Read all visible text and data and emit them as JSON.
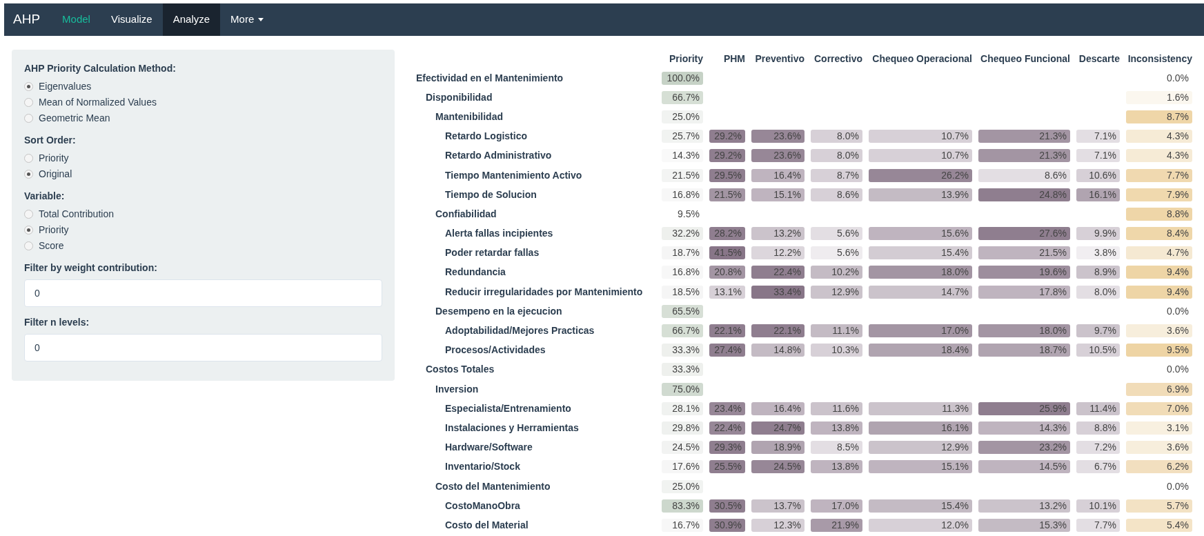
{
  "navbar": {
    "brand": "AHP",
    "items": [
      {
        "label": "Model",
        "kind": "link",
        "selected": false,
        "highlighted": true
      },
      {
        "label": "Visualize",
        "kind": "link",
        "selected": false,
        "highlighted": false
      },
      {
        "label": "Analyze",
        "kind": "link",
        "selected": true,
        "highlighted": false
      },
      {
        "label": "More",
        "kind": "dropdown",
        "selected": false,
        "highlighted": false
      }
    ]
  },
  "sidebar": {
    "groups": [
      {
        "kind": "radio",
        "label": "AHP Priority Calculation Method:",
        "options": [
          {
            "label": "Eigenvalues",
            "selected": true
          },
          {
            "label": "Mean of Normalized Values",
            "selected": false
          },
          {
            "label": "Geometric Mean",
            "selected": false
          }
        ]
      },
      {
        "kind": "radio",
        "label": "Sort Order:",
        "options": [
          {
            "label": "Priority",
            "selected": false
          },
          {
            "label": "Original",
            "selected": true
          }
        ]
      },
      {
        "kind": "radio",
        "label": "Variable:",
        "options": [
          {
            "label": "Total Contribution",
            "selected": false
          },
          {
            "label": "Priority",
            "selected": true
          },
          {
            "label": "Score",
            "selected": false
          }
        ]
      },
      {
        "kind": "input",
        "label": "Filter by weight contribution:",
        "value": "0"
      },
      {
        "kind": "input",
        "label": "Filter n levels:",
        "value": "0"
      }
    ]
  },
  "table": {
    "columns": [
      "Priority",
      "PHM",
      "Preventivo",
      "Correctivo",
      "Chequeo Operacional",
      "Chequeo Funcional",
      "Descarte",
      "Inconsistency"
    ],
    "rows": [
      {
        "name": "Efectividad en el Mantenimiento",
        "priority": {
          "text": "100.0%",
          "color": "#c6d2c6"
        },
        "inconsistency": {
          "text": "0.0%",
          "color": "#ffffff"
        },
        "children": [
          {
            "name": "Disponibilidad",
            "priority": {
              "text": "66.7%",
              "color": "#d6dfd5"
            },
            "inconsistency": {
              "text": "1.6%",
              "color": "#fbf7ef"
            },
            "children": [
              {
                "name": "Mantenibilidad",
                "priority": {
                  "text": "25.0%",
                  "color": "#f1f3f1"
                },
                "inconsistency": {
                  "text": "8.7%",
                  "color": "#efd6a8"
                },
                "children": [
                  {
                    "name": "Retardo Logistico",
                    "priority": {
                      "text": "25.7%",
                      "color": "#f1f3f1"
                    },
                    "scores": [
                      {
                        "text": "29.2%",
                        "color": "#8f7e8f"
                      },
                      {
                        "text": "23.6%",
                        "color": "#978797"
                      },
                      {
                        "text": "8.0%",
                        "color": "#d7d0d7"
                      },
                      {
                        "text": "10.7%",
                        "color": "#d7d0d7"
                      },
                      {
                        "text": "21.3%",
                        "color": "#a395a3"
                      },
                      {
                        "text": "7.1%",
                        "color": "#e3dee3"
                      }
                    ],
                    "inconsistency": {
                      "text": "4.3%",
                      "color": "#f6ebd6"
                    }
                  },
                  {
                    "name": "Retardo Administrativo",
                    "priority": {
                      "text": "14.3%",
                      "color": "#f9f9f9"
                    },
                    "scores": [
                      {
                        "text": "29.2%",
                        "color": "#8f7e8f"
                      },
                      {
                        "text": "23.6%",
                        "color": "#978797"
                      },
                      {
                        "text": "8.0%",
                        "color": "#d7d0d7"
                      },
                      {
                        "text": "10.7%",
                        "color": "#d7d0d7"
                      },
                      {
                        "text": "21.3%",
                        "color": "#a395a3"
                      },
                      {
                        "text": "7.1%",
                        "color": "#e3dee3"
                      }
                    ],
                    "inconsistency": {
                      "text": "4.3%",
                      "color": "#f6ebd6"
                    }
                  },
                  {
                    "name": "Tiempo Mantenimiento Activo",
                    "priority": {
                      "text": "21.5%",
                      "color": "#f3f4f3"
                    },
                    "scores": [
                      {
                        "text": "29.5%",
                        "color": "#8f7e8f"
                      },
                      {
                        "text": "16.4%",
                        "color": "#bfb4bf"
                      },
                      {
                        "text": "8.7%",
                        "color": "#d7d0d7"
                      },
                      {
                        "text": "26.2%",
                        "color": "#978797"
                      },
                      {
                        "text": "8.6%",
                        "color": "#e3dee3"
                      },
                      {
                        "text": "10.6%",
                        "color": "#d7d0d7"
                      }
                    ],
                    "inconsistency": {
                      "text": "7.7%",
                      "color": "#f0d9b0"
                    }
                  },
                  {
                    "name": "Tiempo de Solucion",
                    "priority": {
                      "text": "16.8%",
                      "color": "#f7f7f7"
                    },
                    "scores": [
                      {
                        "text": "21.5%",
                        "color": "#a395a3"
                      },
                      {
                        "text": "15.1%",
                        "color": "#bfb4bf"
                      },
                      {
                        "text": "8.6%",
                        "color": "#d7d0d7"
                      },
                      {
                        "text": "13.9%",
                        "color": "#c4bbc4"
                      },
                      {
                        "text": "24.8%",
                        "color": "#8f7e8f"
                      },
                      {
                        "text": "16.1%",
                        "color": "#b0a4b0"
                      }
                    ],
                    "inconsistency": {
                      "text": "7.9%",
                      "color": "#f0d9ae"
                    }
                  }
                ]
              },
              {
                "name": "Confiabilidad",
                "priority": {
                  "text": "9.5%",
                  "color": "#ffffff"
                },
                "inconsistency": {
                  "text": "8.8%",
                  "color": "#efd6a8"
                },
                "children": [
                  {
                    "name": "Alerta fallas incipientes",
                    "priority": {
                      "text": "32.2%",
                      "color": "#eef0ed"
                    },
                    "scores": [
                      {
                        "text": "28.2%",
                        "color": "#8f7e8f"
                      },
                      {
                        "text": "13.2%",
                        "color": "#cbc3cb"
                      },
                      {
                        "text": "5.6%",
                        "color": "#e3dee3"
                      },
                      {
                        "text": "15.6%",
                        "color": "#bfb4bf"
                      },
                      {
                        "text": "27.6%",
                        "color": "#8f7e8f"
                      },
                      {
                        "text": "9.9%",
                        "color": "#d7d0d7"
                      }
                    ],
                    "inconsistency": {
                      "text": "8.4%",
                      "color": "#efd7aa"
                    }
                  },
                  {
                    "name": "Poder retardar fallas",
                    "priority": {
                      "text": "18.7%",
                      "color": "#f5f5f5"
                    },
                    "scores": [
                      {
                        "text": "41.5%",
                        "color": "#887688"
                      },
                      {
                        "text": "12.2%",
                        "color": "#dcd6dc"
                      },
                      {
                        "text": "5.6%",
                        "color": "#efecef"
                      },
                      {
                        "text": "15.4%",
                        "color": "#d3ccd3"
                      },
                      {
                        "text": "21.5%",
                        "color": "#bfb4bf"
                      },
                      {
                        "text": "3.8%",
                        "color": "#f1eef1"
                      }
                    ],
                    "inconsistency": {
                      "text": "4.7%",
                      "color": "#f5e9d2"
                    }
                  },
                  {
                    "name": "Redundancia",
                    "priority": {
                      "text": "16.8%",
                      "color": "#f7f7f7"
                    },
                    "scores": [
                      {
                        "text": "20.8%",
                        "color": "#a395a3"
                      },
                      {
                        "text": "22.4%",
                        "color": "#8f7e8f"
                      },
                      {
                        "text": "10.2%",
                        "color": "#c4bbc4"
                      },
                      {
                        "text": "18.0%",
                        "color": "#a395a3"
                      },
                      {
                        "text": "19.6%",
                        "color": "#9d8e9d"
                      },
                      {
                        "text": "8.9%",
                        "color": "#cbc3cb"
                      }
                    ],
                    "inconsistency": {
                      "text": "9.4%",
                      "color": "#eed5a6"
                    }
                  },
                  {
                    "name": "Reducir irregularidades por Mantenimiento",
                    "priority": {
                      "text": "18.5%",
                      "color": "#f5f5f5"
                    },
                    "scores": [
                      {
                        "text": "13.1%",
                        "color": "#d7d0d7"
                      },
                      {
                        "text": "33.4%",
                        "color": "#887688"
                      },
                      {
                        "text": "12.9%",
                        "color": "#cbc3cb"
                      },
                      {
                        "text": "14.7%",
                        "color": "#cbc3cb"
                      },
                      {
                        "text": "17.8%",
                        "color": "#bfb4bf"
                      },
                      {
                        "text": "8.0%",
                        "color": "#e3dee3"
                      }
                    ],
                    "inconsistency": {
                      "text": "9.4%",
                      "color": "#eed5a6"
                    }
                  }
                ]
              },
              {
                "name": "Desempeno en la ejecucion",
                "priority": {
                  "text": "65.5%",
                  "color": "#d7dfd6"
                },
                "inconsistency": {
                  "text": "0.0%",
                  "color": "#ffffff"
                },
                "children": [
                  {
                    "name": "Adoptabilidad/Mejores Practicas",
                    "priority": {
                      "text": "66.7%",
                      "color": "#d6dfd5"
                    },
                    "scores": [
                      {
                        "text": "22.1%",
                        "color": "#8f7e8f"
                      },
                      {
                        "text": "22.1%",
                        "color": "#8f7e8f"
                      },
                      {
                        "text": "11.1%",
                        "color": "#c4bbc4"
                      },
                      {
                        "text": "17.0%",
                        "color": "#a395a3"
                      },
                      {
                        "text": "18.0%",
                        "color": "#a395a3"
                      },
                      {
                        "text": "9.7%",
                        "color": "#cbc3cb"
                      }
                    ],
                    "inconsistency": {
                      "text": "3.6%",
                      "color": "#f7eedc"
                    }
                  },
                  {
                    "name": "Procesos/Actividades",
                    "priority": {
                      "text": "33.3%",
                      "color": "#eef0ed"
                    },
                    "scores": [
                      {
                        "text": "27.4%",
                        "color": "#8f7e8f"
                      },
                      {
                        "text": "14.8%",
                        "color": "#c4bbc4"
                      },
                      {
                        "text": "10.3%",
                        "color": "#d7d0d7"
                      },
                      {
                        "text": "18.4%",
                        "color": "#b0a4b0"
                      },
                      {
                        "text": "18.7%",
                        "color": "#b0a4b0"
                      },
                      {
                        "text": "10.5%",
                        "color": "#d7d0d7"
                      }
                    ],
                    "inconsistency": {
                      "text": "9.5%",
                      "color": "#eed4a4"
                    }
                  }
                ]
              }
            ]
          },
          {
            "name": "Costos Totales",
            "priority": {
              "text": "33.3%",
              "color": "#eef0ed"
            },
            "inconsistency": {
              "text": "0.0%",
              "color": "#ffffff"
            },
            "children": [
              {
                "name": "Inversion",
                "priority": {
                  "text": "75.0%",
                  "color": "#d0dad0"
                },
                "inconsistency": {
                  "text": "6.9%",
                  "color": "#f1dcb8"
                },
                "children": [
                  {
                    "name": "Especialista/Entrenamiento",
                    "priority": {
                      "text": "28.1%",
                      "color": "#f0f2f0"
                    },
                    "scores": [
                      {
                        "text": "23.4%",
                        "color": "#978797"
                      },
                      {
                        "text": "16.4%",
                        "color": "#bfb4bf"
                      },
                      {
                        "text": "11.6%",
                        "color": "#cbc3cb"
                      },
                      {
                        "text": "11.3%",
                        "color": "#cbc3cb"
                      },
                      {
                        "text": "25.9%",
                        "color": "#8f7e8f"
                      },
                      {
                        "text": "11.4%",
                        "color": "#cbc3cb"
                      }
                    ],
                    "inconsistency": {
                      "text": "7.0%",
                      "color": "#f1dcb7"
                    }
                  },
                  {
                    "name": "Instalaciones y Herramientas",
                    "priority": {
                      "text": "29.8%",
                      "color": "#eff1ef"
                    },
                    "scores": [
                      {
                        "text": "22.4%",
                        "color": "#978797"
                      },
                      {
                        "text": "24.7%",
                        "color": "#8f7e8f"
                      },
                      {
                        "text": "13.8%",
                        "color": "#bfb4bf"
                      },
                      {
                        "text": "16.1%",
                        "color": "#b0a4b0"
                      },
                      {
                        "text": "14.3%",
                        "color": "#bfb4bf"
                      },
                      {
                        "text": "8.8%",
                        "color": "#d7d0d7"
                      }
                    ],
                    "inconsistency": {
                      "text": "3.1%",
                      "color": "#f8f0e0"
                    }
                  },
                  {
                    "name": "Hardware/Software",
                    "priority": {
                      "text": "24.5%",
                      "color": "#f2f3f2"
                    },
                    "scores": [
                      {
                        "text": "29.3%",
                        "color": "#8f7e8f"
                      },
                      {
                        "text": "18.9%",
                        "color": "#b0a4b0"
                      },
                      {
                        "text": "8.5%",
                        "color": "#e3dee3"
                      },
                      {
                        "text": "12.9%",
                        "color": "#cbc3cb"
                      },
                      {
                        "text": "23.2%",
                        "color": "#a395a3"
                      },
                      {
                        "text": "7.2%",
                        "color": "#e3dee3"
                      }
                    ],
                    "inconsistency": {
                      "text": "3.6%",
                      "color": "#f7eedc"
                    }
                  },
                  {
                    "name": "Inventario/Stock",
                    "priority": {
                      "text": "17.6%",
                      "color": "#f6f6f6"
                    },
                    "scores": [
                      {
                        "text": "25.5%",
                        "color": "#8f7e8f"
                      },
                      {
                        "text": "24.5%",
                        "color": "#978797"
                      },
                      {
                        "text": "13.8%",
                        "color": "#bfb4bf"
                      },
                      {
                        "text": "15.1%",
                        "color": "#bfb4bf"
                      },
                      {
                        "text": "14.5%",
                        "color": "#bfb4bf"
                      },
                      {
                        "text": "6.7%",
                        "color": "#e3dee3"
                      }
                    ],
                    "inconsistency": {
                      "text": "6.2%",
                      "color": "#f2dfbf"
                    }
                  }
                ]
              },
              {
                "name": "Costo del Mantenimiento",
                "priority": {
                  "text": "25.0%",
                  "color": "#f1f3f1"
                },
                "inconsistency": {
                  "text": "0.0%",
                  "color": "#ffffff"
                },
                "children": [
                  {
                    "name": "CostoManoObra",
                    "priority": {
                      "text": "83.3%",
                      "color": "#cdd8cd"
                    },
                    "scores": [
                      {
                        "text": "30.5%",
                        "color": "#8f7e8f"
                      },
                      {
                        "text": "13.7%",
                        "color": "#cbc3cb"
                      },
                      {
                        "text": "17.0%",
                        "color": "#bfb4bf"
                      },
                      {
                        "text": "15.4%",
                        "color": "#c4bbc4"
                      },
                      {
                        "text": "13.2%",
                        "color": "#cbc3cb"
                      },
                      {
                        "text": "10.1%",
                        "color": "#d7d0d7"
                      }
                    ],
                    "inconsistency": {
                      "text": "5.7%",
                      "color": "#f3e2c4"
                    }
                  },
                  {
                    "name": "Costo del Material",
                    "priority": {
                      "text": "16.7%",
                      "color": "#f7f7f7"
                    },
                    "scores": [
                      {
                        "text": "30.9%",
                        "color": "#8f7e8f"
                      },
                      {
                        "text": "12.3%",
                        "color": "#d7d0d7"
                      },
                      {
                        "text": "21.9%",
                        "color": "#a89aa8"
                      },
                      {
                        "text": "12.0%",
                        "color": "#d7d0d7"
                      },
                      {
                        "text": "15.3%",
                        "color": "#c4bbc4"
                      },
                      {
                        "text": "7.7%",
                        "color": "#e3dee3"
                      }
                    ],
                    "inconsistency": {
                      "text": "5.4%",
                      "color": "#f4e4c7"
                    }
                  }
                ]
              }
            ]
          }
        ]
      }
    ]
  }
}
